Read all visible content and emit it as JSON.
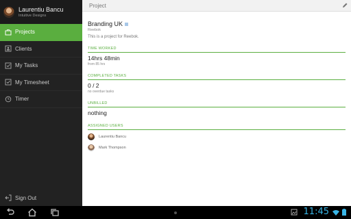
{
  "user": {
    "name": "Laurentiu Bancu",
    "org": "Intuitive Designs"
  },
  "nav": [
    {
      "label": "Projects",
      "icon": "briefcase-icon",
      "active": true
    },
    {
      "label": "Clients",
      "icon": "contact-card-icon"
    },
    {
      "label": "My Tasks",
      "icon": "checkbox-icon"
    },
    {
      "label": "My Timesheet",
      "icon": "timesheet-icon"
    },
    {
      "label": "Timer",
      "icon": "clock-icon"
    }
  ],
  "signout": {
    "label": "Sign Out",
    "icon": "sign-out-icon"
  },
  "header": {
    "title": "Project"
  },
  "project": {
    "name": "Branding UK",
    "client": "Reebok",
    "description": "This is a project for Reebok.",
    "color": "#a7c7e7"
  },
  "sections": {
    "time_worked": {
      "heading": "TIME WORKED",
      "value": "14hrs 48min",
      "sub": "from 85 hrs"
    },
    "completed_tasks": {
      "heading": "COMPLETED TASKS",
      "value": "0 / 2",
      "sub": "no overdue tasks"
    },
    "unbilled": {
      "heading": "UNBILLED",
      "value": "nothing"
    },
    "assigned_users": {
      "heading": "ASSIGNED USERS",
      "users": [
        "Laurentiu Bancu",
        "Mark Thompson"
      ]
    }
  },
  "system": {
    "clock": "11:45"
  },
  "colors": {
    "accent": "#5aae3f",
    "sidebar": "#222222",
    "clock": "#39b5e6"
  }
}
